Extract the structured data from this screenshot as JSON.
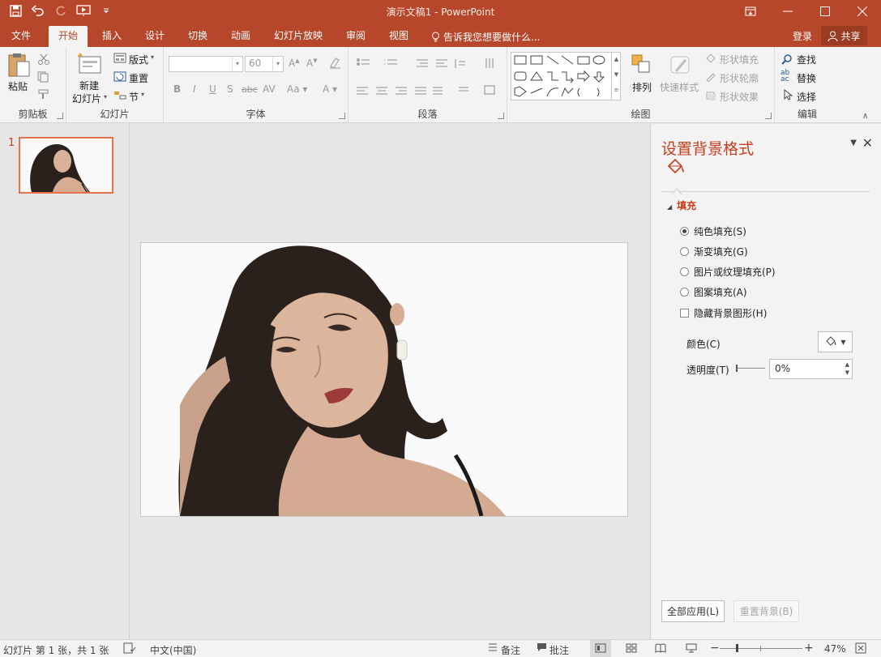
{
  "window": {
    "title": "演示文稿1 - PowerPoint"
  },
  "tabs": [
    {
      "label": "文件"
    },
    {
      "label": "开始"
    },
    {
      "label": "插入"
    },
    {
      "label": "设计"
    },
    {
      "label": "切换"
    },
    {
      "label": "动画"
    },
    {
      "label": "幻灯片放映"
    },
    {
      "label": "审阅"
    },
    {
      "label": "视图"
    }
  ],
  "active_tab": "开始",
  "tellme": "告诉我您想要做什么...",
  "account": {
    "login": "登录",
    "share": "共享"
  },
  "ribbon": {
    "clipboard": {
      "paste": "粘贴",
      "label": "剪贴板"
    },
    "slides": {
      "new_slide_line1": "新建",
      "new_slide_line2": "幻灯片",
      "layout": "版式",
      "reset": "重置",
      "section": "节",
      "label": "幻灯片"
    },
    "font": {
      "size": "60",
      "label": "字体"
    },
    "paragraph": {
      "label": "段落"
    },
    "drawing": {
      "arrange": "排列",
      "quick_styles": "快速样式",
      "shape_fill": "形状填充",
      "shape_outline": "形状轮廓",
      "shape_effects": "形状效果",
      "label": "绘图"
    },
    "editing": {
      "find": "查找",
      "replace": "替换",
      "select": "选择",
      "label": "编辑"
    }
  },
  "slides_pane": {
    "slide_number": "1"
  },
  "format_pane": {
    "title": "设置背景格式",
    "section": "填充",
    "options": [
      {
        "label": "纯色填充(S)",
        "selected": true
      },
      {
        "label": "渐变填充(G)",
        "selected": false
      },
      {
        "label": "图片或纹理填充(P)",
        "selected": false
      },
      {
        "label": "图案填充(A)",
        "selected": false
      }
    ],
    "hide_graphics": "隐藏背景图形(H)",
    "color_label": "颜色(C)",
    "transparency_label": "透明度(T)",
    "transparency_value": "0%",
    "apply_all": "全部应用(L)",
    "reset_bg": "重置背景(B)"
  },
  "status": {
    "slide_info": "幻灯片 第 1 张，共 1 张",
    "language": "中文(中国)",
    "notes": "备注",
    "comments": "批注",
    "zoom": "47%"
  },
  "colors": {
    "accent": "#b7472a",
    "accent_text": "#c43e1c",
    "selection": "#e8714e"
  }
}
